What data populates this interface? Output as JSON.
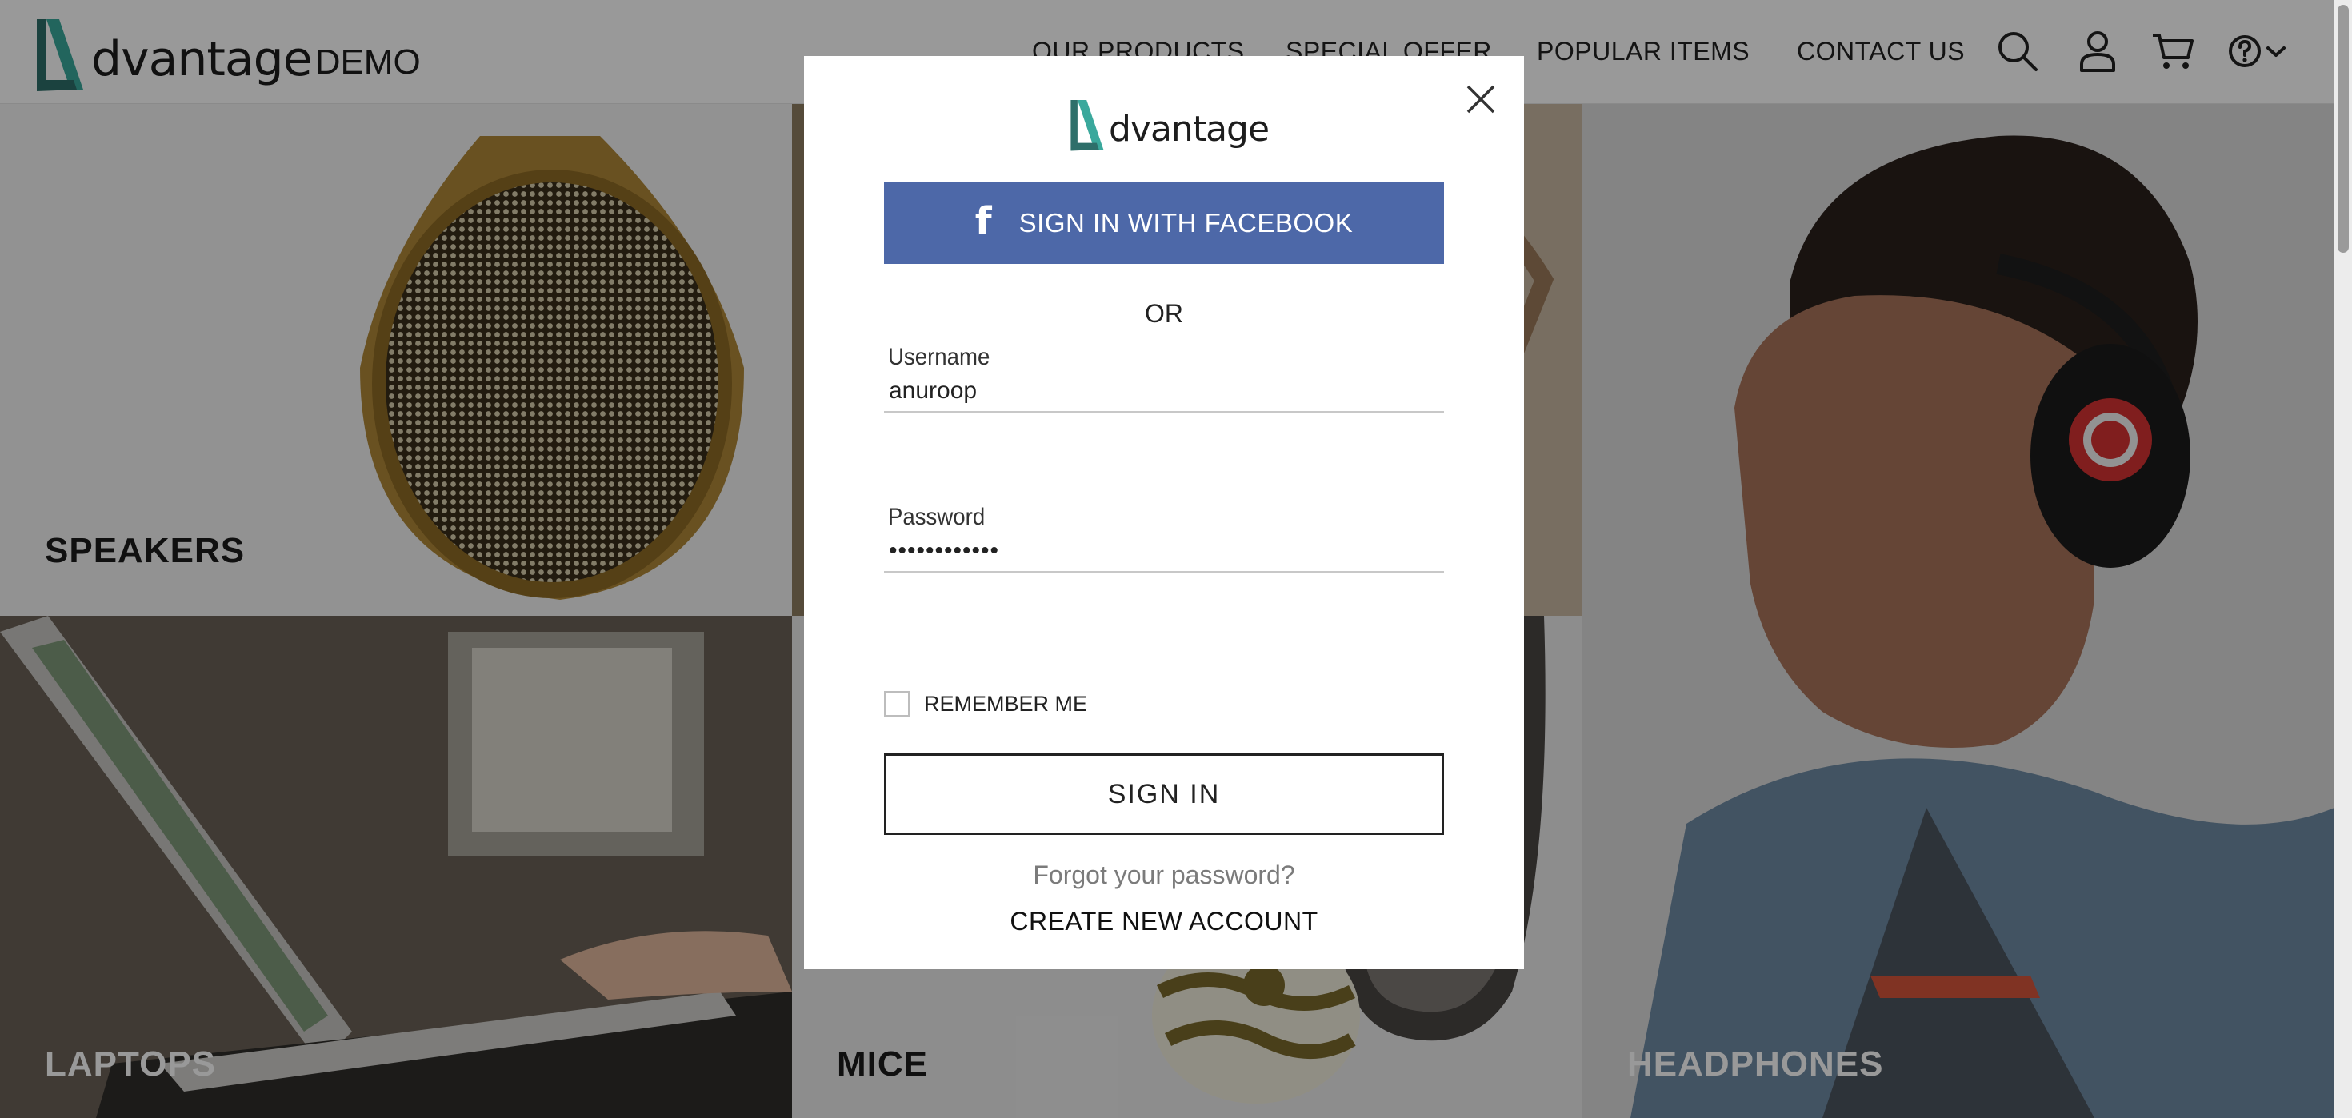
{
  "header": {
    "logo_word": "dvantage",
    "logo_suffix": "DEMO",
    "nav": [
      "OUR PRODUCTS",
      "SPECIAL OFFER",
      "POPULAR ITEMS",
      "CONTACT US"
    ],
    "icons": [
      "search-icon",
      "user-icon",
      "cart-icon",
      "help-icon",
      "chevron-down-icon"
    ]
  },
  "categories": {
    "speakers": "SPEAKERS",
    "laptops": "LAPTOPS",
    "mice": "MICE",
    "headphones": "HEADPHONES"
  },
  "modal": {
    "logo_word": "dvantage",
    "facebook_button": "SIGN IN WITH FACEBOOK",
    "or": "OR",
    "username_label": "Username",
    "username_value": "anuroop",
    "password_label": "Password",
    "password_value": "••••••••••••",
    "remember_label": "REMEMBER ME",
    "remember_checked": false,
    "signin_button": "SIGN IN",
    "forgot_link": "Forgot your password?",
    "create_account": "CREATE NEW ACCOUNT"
  },
  "colors": {
    "brand_teal": "#2e9d93",
    "facebook_blue": "#4d68a8",
    "overlay": "rgba(0,0,0,0.4)"
  }
}
